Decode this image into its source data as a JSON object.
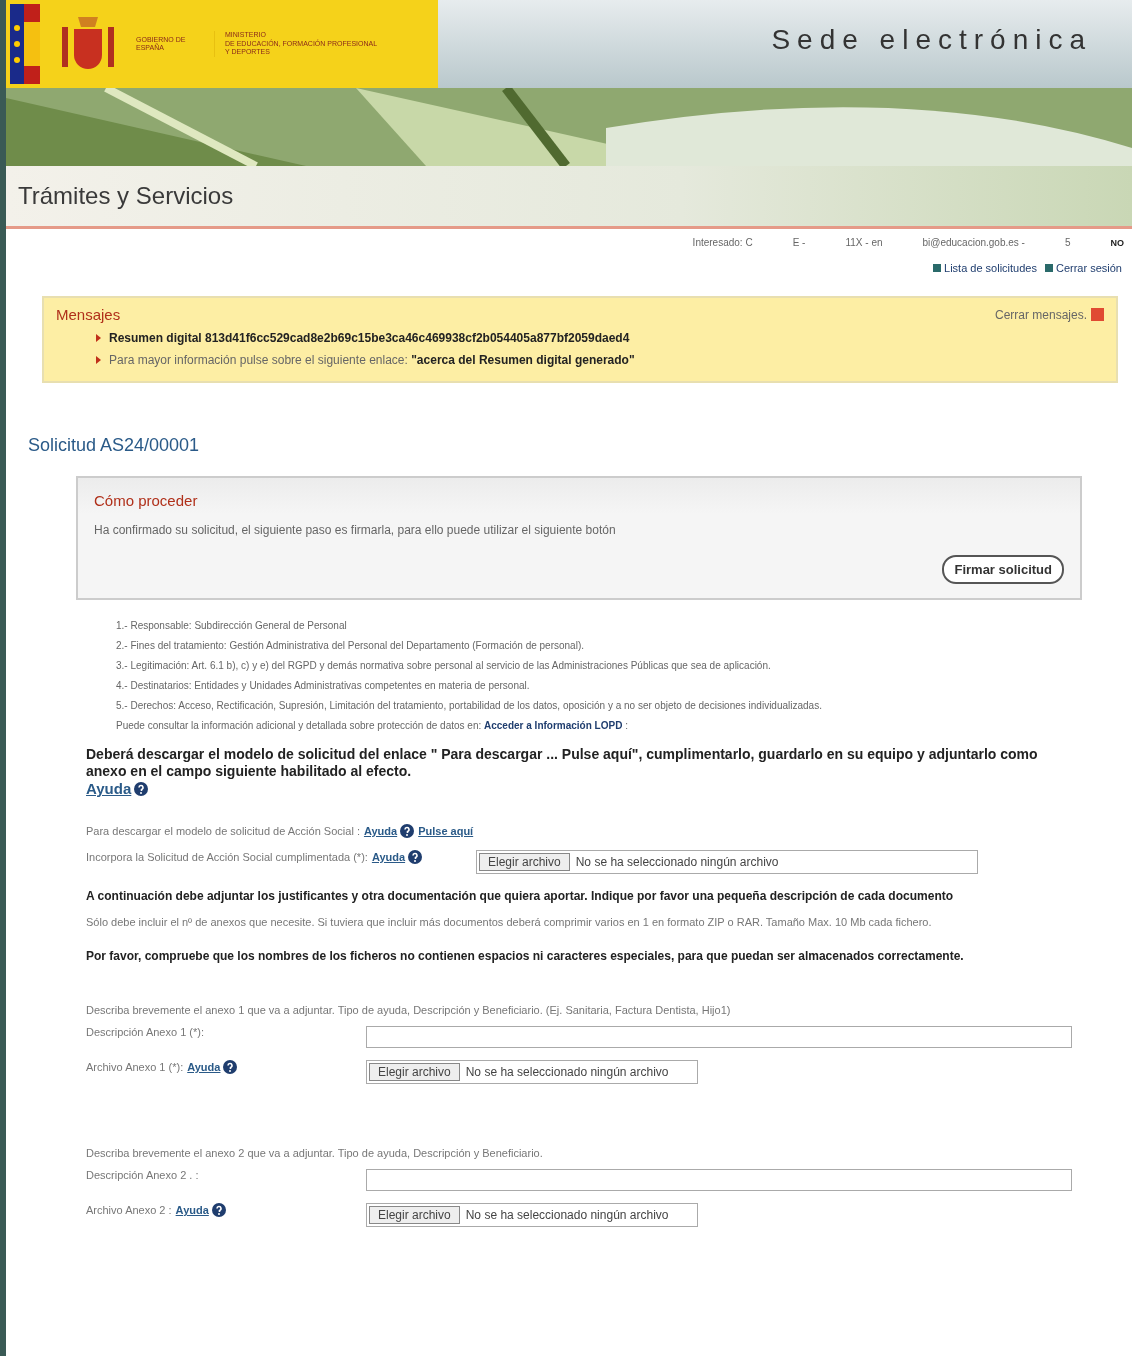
{
  "header": {
    "gov_name": "GOBIERNO DE ESPAÑA",
    "ministry_lines": [
      "MINISTERIO",
      "DE EDUCACIÓN, FORMACIÓN PROFESIONAL",
      "Y DEPORTES"
    ],
    "site_title": "Sede electrónica",
    "section_title": "Trámites y Servicios"
  },
  "user_bar": {
    "fields": [
      "Interesado: C",
      "E -",
      "11X - en",
      "bi@educacion.gob.es -",
      "5"
    ],
    "badge": "NO",
    "links": [
      "Lista de solicitudes",
      "Cerrar sesión"
    ]
  },
  "messages": {
    "title": "Mensajes",
    "close": "Cerrar mensajes.",
    "items": [
      {
        "text": "**Resumen digital 813d41f6cc529cad8e2b69c15be3ca46c469938cf2b054405a877bf2059daed4**"
      },
      {
        "text": "Para mayor información pulse sobre el siguiente enlace: **\"acerca del Resumen digital generado\"**"
      }
    ]
  },
  "request_title": "Solicitud AS24/00001",
  "how_to": {
    "title": "Cómo proceder",
    "text": "Ha confirmado su solicitud, el siguiente paso es firmarla, para ello puede utilizar el siguiente botón",
    "button": "Firmar solicitud"
  },
  "privacy": {
    "items": [
      "1.- Responsable: Subdirección General de Personal",
      "2.- Fines del tratamiento: Gestión Administrativa del Personal del Departamento (Formación de personal).",
      "3.- Legitimación: Art. 6.1 b), c) y e) del RGPD y demás normativa sobre personal al servicio de las Administraciones Públicas que sea de aplicación.",
      "4.- Destinatarios: Entidades y Unidades Administrativas competentes en materia de personal.",
      "5.- Derechos: Acceso, Rectificación, Supresión, Limitación del tratamiento, portabilidad de los datos, oposición y a no ser objeto de decisiones individualizadas."
    ],
    "more": "Puede consultar la información adicional y detallada sobre protección de datos en:",
    "link": "Acceder a Información LOPD",
    "link_suffix": ":"
  },
  "download_note": "Deberá descargar el modelo de solicitud del enlace \" Para descargar ... Pulse aquí\", cumplimentarlo, guardarlo en su equipo y adjuntarlo como anexo en el campo siguiente habilitado al efecto.",
  "download_help": "Ayuda",
  "model_row": {
    "label": "Para descargar el modelo de solicitud de Acción Social :",
    "help": "Ayuda",
    "link": "Pulse aquí"
  },
  "upload_row": {
    "label": "Incorpora la Solicitud de Acción Social cumplimentada (*):",
    "help": "Ayuda",
    "button": "Elegir archivo",
    "status": "No se ha seleccionado ningún archivo"
  },
  "attach_note": "A continuación debe adjuntar los justificantes y otra documentación que quiera aportar. Indique por favor una pequeña descripción de cada documento",
  "attach_hint": "Sólo debe incluir el nº de anexos que necesite. Si tuviera que incluir más documentos deberá comprimir varios en 1 en formato ZIP o RAR. Tamaño Max. 10 Mb cada fichero.",
  "names_note": "Por favor, compruebe que los nombres de los ficheros no contienen espacios ni caracteres especiales, para que puedan ser almacenados correctamente.",
  "annexes": [
    {
      "intro": "Describa brevemente el anexo 1 que va a adjuntar. Tipo de ayuda, Descripción y Beneficiario. (Ej. Sanitaria, Factura Dentista, Hijo1)",
      "desc_label": "Descripción Anexo 1 (*):",
      "file_label": "Archivo Anexo 1 (*):",
      "help": "Ayuda",
      "button": "Elegir archivo",
      "status": "No se ha seleccionado ningún archivo"
    },
    {
      "intro": "Describa brevemente el anexo 2 que va a adjuntar. Tipo de ayuda, Descripción y Beneficiario.",
      "desc_label": "Descripción Anexo 2 . :",
      "file_label": "Archivo Anexo 2 :",
      "help": "Ayuda",
      "button": "Elegir archivo",
      "status": "No se ha seleccionado ningún archivo"
    }
  ]
}
